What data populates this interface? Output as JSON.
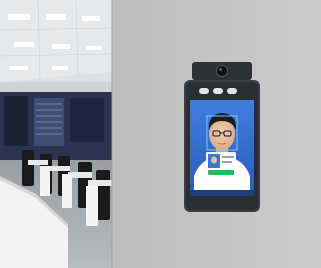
{
  "photo": {
    "subject": "face-recognition-terminal",
    "colors": {
      "wall": "#c4c4c4",
      "device_body": "#3a3d42",
      "screen_accent": "#2c6fd8",
      "office_ceiling": "#e4e6e8",
      "office_glass": "#1f2a44"
    }
  },
  "device": {
    "footer_text": "",
    "status": {
      "verified": true
    }
  }
}
